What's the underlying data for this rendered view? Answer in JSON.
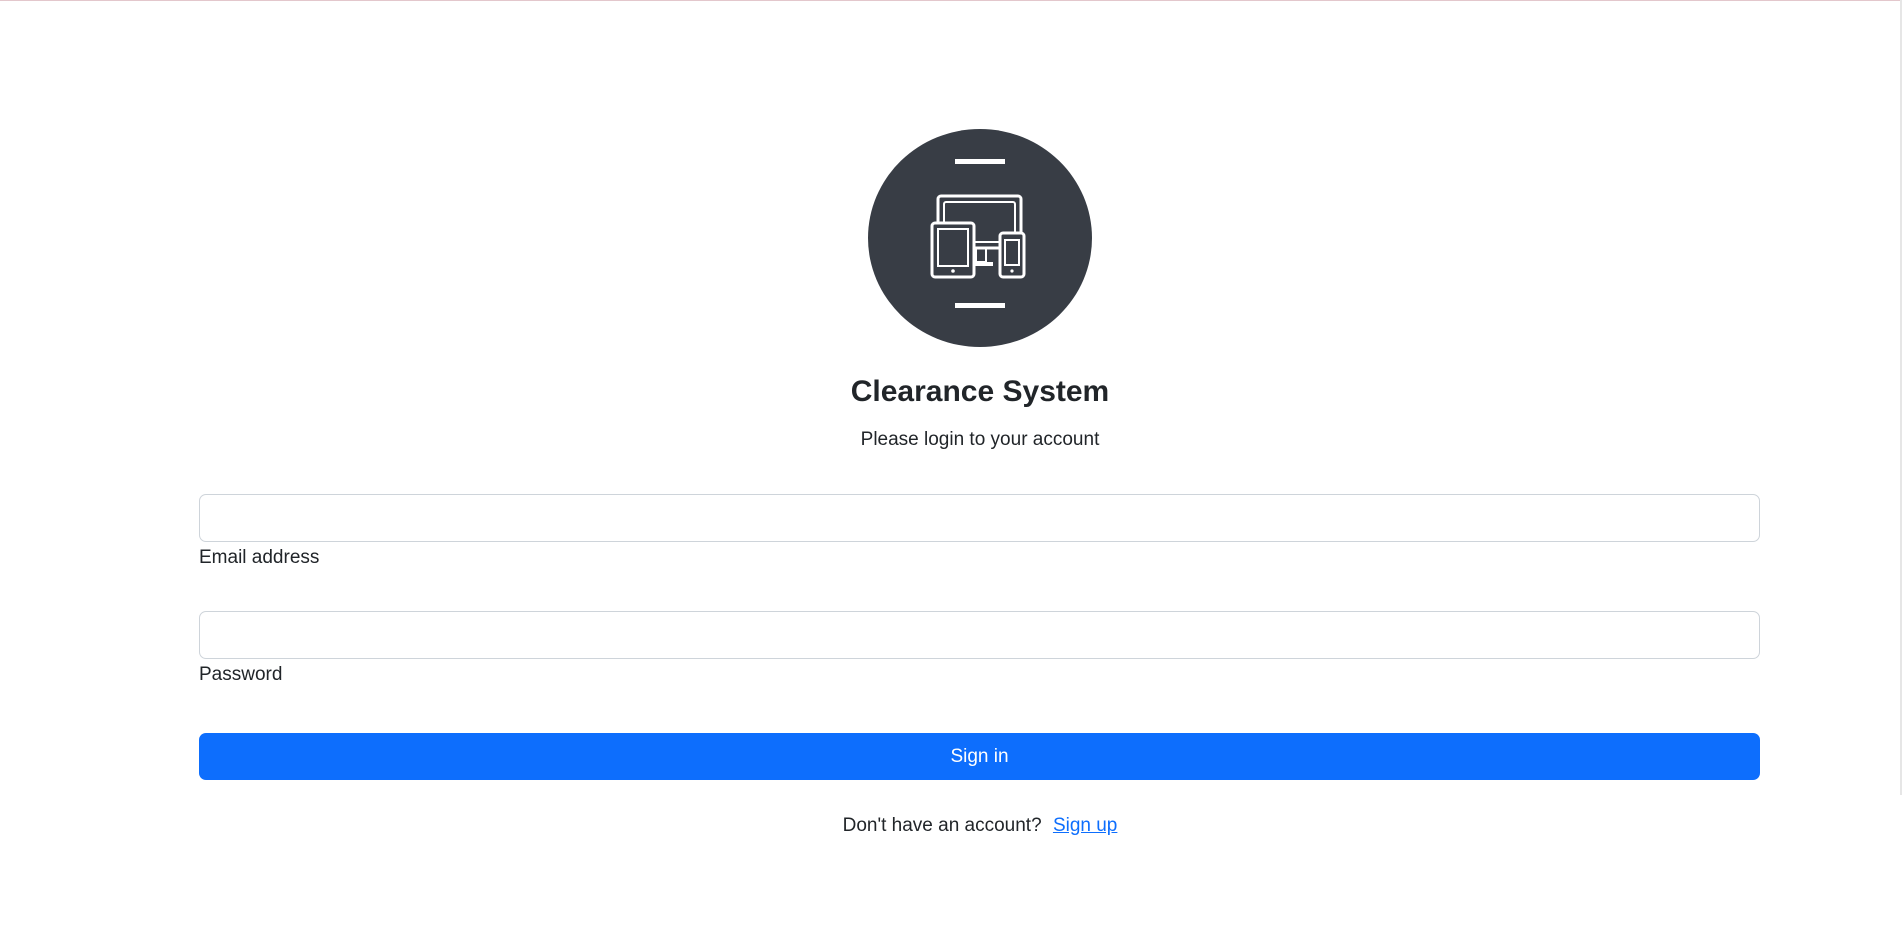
{
  "app": {
    "title": "Clearance System",
    "subtitle": "Please login to your account",
    "logo_icon": "devices-icon",
    "logo_bg_color": "#383d45"
  },
  "form": {
    "email": {
      "label": "Email address",
      "value": "",
      "placeholder": ""
    },
    "password": {
      "label": "Password",
      "value": "",
      "placeholder": ""
    },
    "signin_label": "Sign in",
    "accent_color": "#0d6efd"
  },
  "footer": {
    "prompt": "Don't have an account?",
    "signup_label": "Sign up"
  }
}
